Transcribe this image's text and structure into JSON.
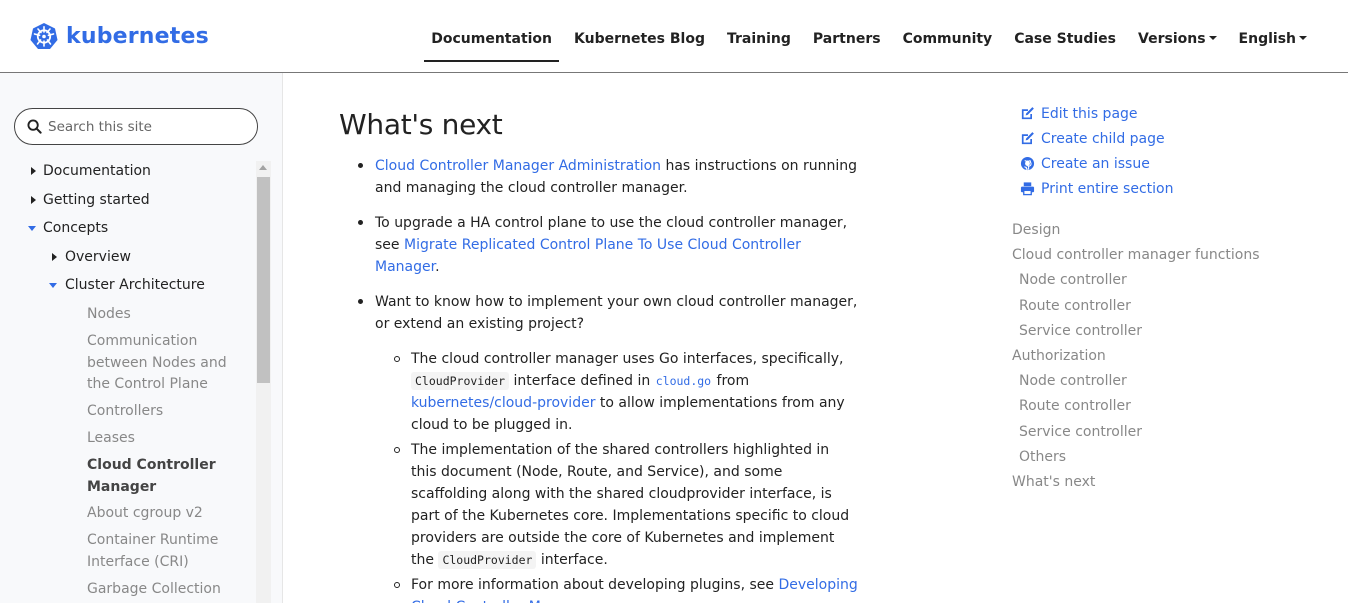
{
  "header": {
    "logo_text": "kubernetes",
    "nav": [
      {
        "label": "Documentation",
        "active": true
      },
      {
        "label": "Kubernetes Blog"
      },
      {
        "label": "Training"
      },
      {
        "label": "Partners"
      },
      {
        "label": "Community"
      },
      {
        "label": "Case Studies"
      },
      {
        "label": "Versions",
        "dropdown": true
      },
      {
        "label": "English",
        "dropdown": true
      }
    ]
  },
  "sidebar": {
    "search_placeholder": "Search this site",
    "tree": [
      {
        "label": "Documentation",
        "state": "collapsed"
      },
      {
        "label": "Getting started",
        "state": "collapsed"
      },
      {
        "label": "Concepts",
        "state": "expanded"
      },
      {
        "label": "Overview",
        "state": "collapsed"
      },
      {
        "label": "Cluster Architecture",
        "state": "expanded"
      }
    ],
    "leaves": [
      "Nodes",
      "Communication between Nodes and the Control Plane",
      "Controllers",
      "Leases",
      "Cloud Controller Manager",
      "About cgroup v2",
      "Container Runtime Interface (CRI)",
      "Garbage Collection"
    ]
  },
  "main": {
    "title": "What's next",
    "b1_link": "Cloud Controller Manager Administration",
    "b1_text": " has instructions on running and managing the cloud controller manager.",
    "b2_text": "To upgrade a HA control plane to use the cloud controller manager, see ",
    "b2_link": "Migrate Replicated Control Plane To Use Cloud Controller Manager",
    "b2_end": ".",
    "b3_text": "Want to know how to implement your own cloud controller manager, or extend an existing project?",
    "s1_a": "The cloud controller manager uses Go interfaces, specifically, ",
    "s1_code": "CloudProvider",
    "s1_b": " interface defined in ",
    "s1_code_link": "cloud.go",
    "s1_c": " from ",
    "s1_link": "kubernetes/cloud-provider",
    "s1_d": " to allow implementations from any cloud to be plugged in.",
    "s2_a": "The implementation of the shared controllers highlighted in this document (Node, Route, and Service), and some scaffolding along with the shared cloudprovider interface, is part of the Kubernetes core. Implementations specific to cloud providers are outside the core of Kubernetes and implement the ",
    "s2_code": "CloudProvider",
    "s2_b": " interface.",
    "s3_a": "For more information about developing plugins, see ",
    "s3_link": "Developing Cloud Controller Manager",
    "s3_b": "."
  },
  "toc_actions": [
    {
      "label": "Edit this page",
      "icon": "edit-icon"
    },
    {
      "label": "Create child page",
      "icon": "edit-icon"
    },
    {
      "label": "Create an issue",
      "icon": "github-icon"
    },
    {
      "label": "Print entire section",
      "icon": "print-icon"
    }
  ],
  "toc": [
    {
      "label": "Design",
      "level": 1
    },
    {
      "label": "Cloud controller manager functions",
      "level": 1
    },
    {
      "label": "Node controller",
      "level": 2
    },
    {
      "label": "Route controller",
      "level": 2
    },
    {
      "label": "Service controller",
      "level": 2
    },
    {
      "label": "Authorization",
      "level": 1
    },
    {
      "label": "Node controller",
      "level": 2
    },
    {
      "label": "Route controller",
      "level": 2
    },
    {
      "label": "Service controller",
      "level": 2
    },
    {
      "label": "Others",
      "level": 2
    },
    {
      "label": "What's next",
      "level": 1
    }
  ],
  "colors": {
    "brand": "#326ce5",
    "muted": "#888888"
  }
}
